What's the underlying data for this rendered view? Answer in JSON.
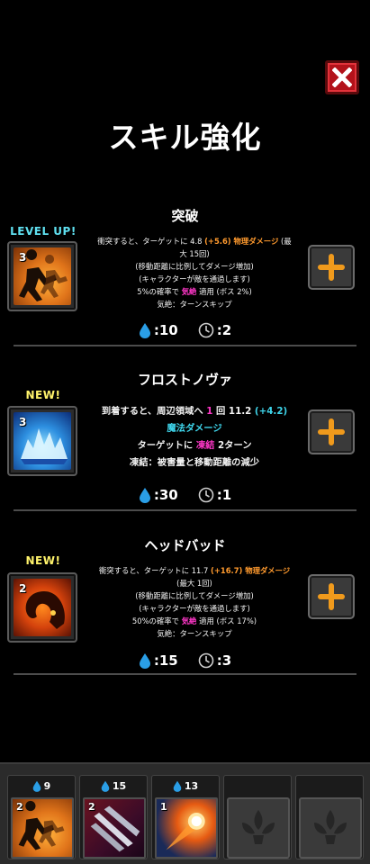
{
  "header": {
    "title": "スキル強化",
    "close_icon": "close-x-icon"
  },
  "skills": [
    {
      "name": "突破",
      "badge": "LEVEL UP!",
      "level": "3",
      "icon": "dash-silhouette-icon",
      "desc": {
        "l1a": "衝突すると、ターゲットに 4.8 ",
        "l1b": "(+5.6)",
        "l1c": " 物理ダメージ",
        "l1d": " (最",
        "l2": "大 15回)",
        "l3": "(移動距離に比例してダメージ増加)",
        "l4": "(キャラクターが敵を通過します)",
        "l5a": "5%の確率で ",
        "l5b": "気絶",
        "l5c": " 適用 (ボス 2%)",
        "l6": "気絶：ターンスキップ"
      },
      "mana": ":10",
      "cooldown": ":2"
    },
    {
      "name": "フロストノヴァ",
      "badge": "NEW!",
      "level": "3",
      "icon": "ice-crystal-icon",
      "desc": {
        "l1a": "到着すると、周辺領域へ ",
        "l1b": "1",
        "l1c": " 回 11.2 ",
        "l1d": "(+4.2)",
        "l2": "魔法ダメージ",
        "l3a": "ターゲットに ",
        "l3b": "凍結",
        "l3c": " 2ターン",
        "l4": "凍結：被害量と移動距離の減少"
      },
      "mana": ":30",
      "cooldown": ":1"
    },
    {
      "name": "ヘッドバッド",
      "badge": "NEW!",
      "level": "2",
      "icon": "ram-head-icon",
      "desc": {
        "l1a": "衝突すると、ターゲットに 11.7 ",
        "l1b": "(+16.7)",
        "l1c": " 物理ダメージ",
        "l2": "(最大 1回)",
        "l3": "(移動距離に比例してダメージ増加)",
        "l4": "(キャラクターが敵を通過します)",
        "l5a": "50%の確率で ",
        "l5b": "気絶",
        "l5c": " 適用 (ボス 17%)",
        "l6": "気絶：ターンスキップ"
      },
      "mana": ":15",
      "cooldown": ":3"
    }
  ],
  "equipped": [
    {
      "cost": "9",
      "level": "2",
      "icon": "dash-silhouette-icon"
    },
    {
      "cost": "15",
      "level": "2",
      "icon": "blades-icon"
    },
    {
      "cost": "13",
      "level": "1",
      "icon": "meteor-icon"
    },
    {
      "cost": "",
      "level": "",
      "icon": "empty-slot-fleur-icon"
    },
    {
      "cost": "",
      "level": "",
      "icon": "empty-slot-fleur-icon"
    }
  ],
  "colors": {
    "damage_physical": "#ff9a2e",
    "damage_magic": "#3ed4ea",
    "status": "#ff37c8",
    "badge_new": "#fff36b",
    "badge_levelup": "#5fe0f0",
    "close_button": "#b3121a",
    "plus_icon": "#f09a1c"
  }
}
